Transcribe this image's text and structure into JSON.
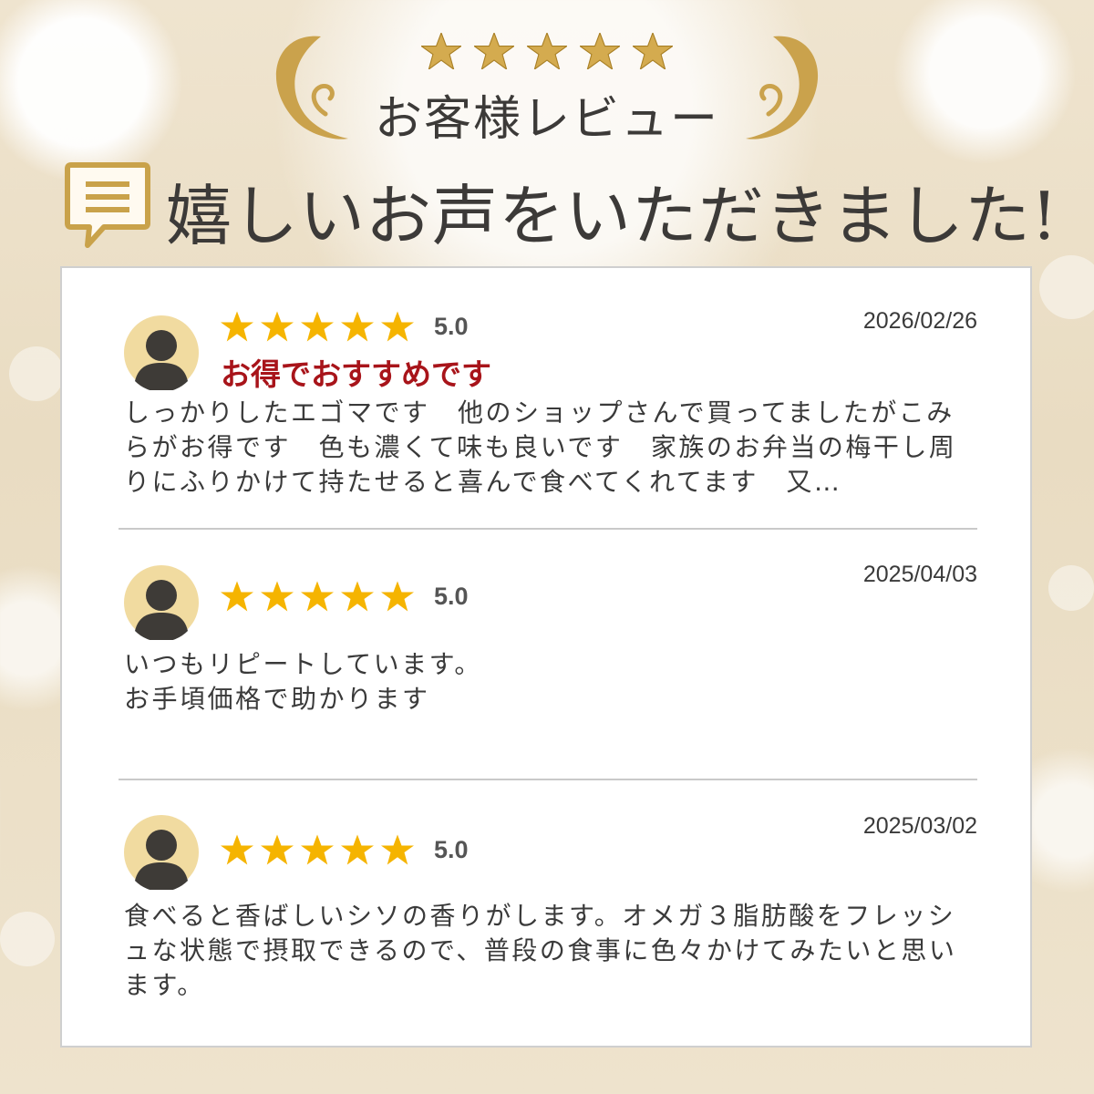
{
  "header": {
    "subtitle": "お客様レビュー",
    "title": "嬉しいお声をいただきました!",
    "gold_stars": 5
  },
  "colors": {
    "gold": "#c9a24a",
    "star_yellow": "#f5b400",
    "headline_red": "#a8141a",
    "avatar_bg": "#f1dba0",
    "avatar_figure": "#3e3b37"
  },
  "reviews": [
    {
      "date": "2026/02/26",
      "rating": 5,
      "score": "5.0",
      "headline": "お得でおすすめです",
      "body": "しっかりしたエゴマです　他のショップさんで買ってましたがこみらがお得です　色も濃くて味も良いです　家族のお弁当の梅干し周りにふりかけて持たせると喜んで食べてくれてます　又…"
    },
    {
      "date": "2025/04/03",
      "rating": 5,
      "score": "5.0",
      "headline": "",
      "body": "いつもリピートしています。\nお手頃価格で助かります"
    },
    {
      "date": "2025/03/02",
      "rating": 5,
      "score": "5.0",
      "headline": "",
      "body": "食べると香ばしいシソの香りがします。オメガ３脂肪酸をフレッシュな状態で摂取できるので、普段の食事に色々かけてみたいと思います。"
    }
  ]
}
